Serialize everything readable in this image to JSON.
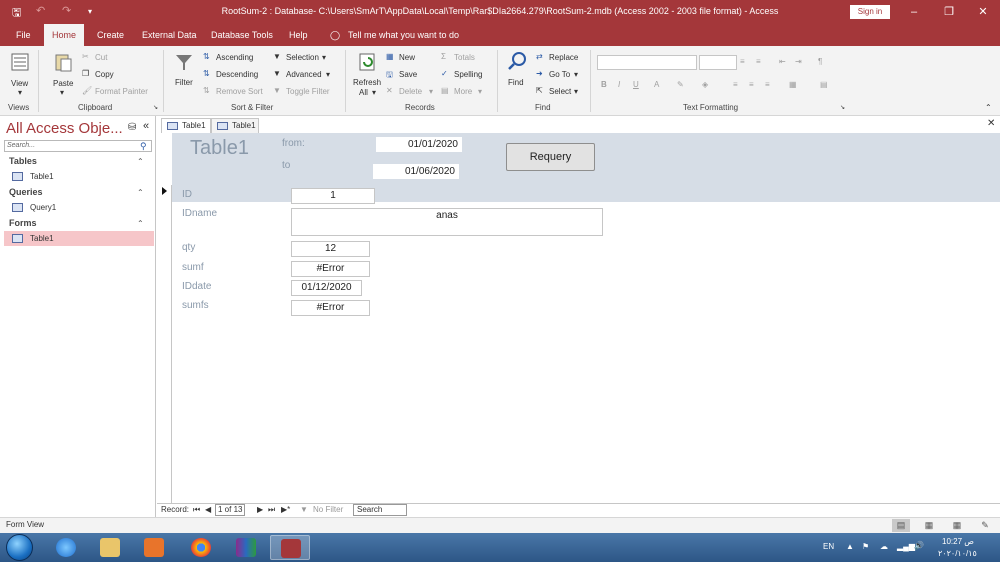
{
  "titlebar": {
    "title": "RootSum-2 : Database- C:\\Users\\SmArT\\AppData\\Local\\Temp\\Rar$DIa2664.279\\RootSum-2.mdb (Access 2002 - 2003 file format)  -  Access",
    "sign_in": "Sign in"
  },
  "ribbon_tabs": [
    "File",
    "Home",
    "Create",
    "External Data",
    "Database Tools",
    "Help"
  ],
  "tell_me": "Tell me what you want to do",
  "ribbon": {
    "views": {
      "view": "View",
      "group": "Views"
    },
    "clipboard": {
      "paste": "Paste",
      "cut": "Cut",
      "copy": "Copy",
      "format_painter": "Format Painter",
      "group": "Clipboard"
    },
    "sort_filter": {
      "filter": "Filter",
      "ascending": "Ascending",
      "descending": "Descending",
      "remove_sort": "Remove Sort",
      "selection": "Selection",
      "advanced": "Advanced",
      "toggle_filter": "Toggle Filter",
      "group": "Sort & Filter"
    },
    "records": {
      "refresh_all": "Refresh",
      "refresh_all2": "All",
      "new": "New",
      "save": "Save",
      "delete": "Delete",
      "totals": "Totals",
      "spelling": "Spelling",
      "more": "More",
      "group": "Records"
    },
    "find": {
      "find": "Find",
      "replace": "Replace",
      "goto": "Go To",
      "select": "Select",
      "group": "Find"
    },
    "text_formatting": {
      "group": "Text Formatting"
    }
  },
  "nav": {
    "title": "All Access Obje...",
    "search_placeholder": "Search...",
    "groups": [
      {
        "name": "Tables",
        "items": [
          "Table1"
        ]
      },
      {
        "name": "Queries",
        "items": [
          "Query1"
        ]
      },
      {
        "name": "Forms",
        "items": [
          "Table1"
        ]
      }
    ]
  },
  "doc_tabs": [
    "Table1",
    "Table1"
  ],
  "form": {
    "title": "Table1",
    "from_label": "from:",
    "from_value": "01/01/2020",
    "to_label": "to",
    "to_value": "01/06/2020",
    "requery": "Requery",
    "fields": [
      {
        "label": "ID",
        "value": "1"
      },
      {
        "label": "IDname",
        "value": "anas"
      },
      {
        "label": "qty",
        "value": "12"
      },
      {
        "label": "sumf",
        "value": "#Error"
      },
      {
        "label": "IDdate",
        "value": "01/12/2020"
      },
      {
        "label": "sumfs",
        "value": "#Error"
      }
    ]
  },
  "record_nav": {
    "label": "Record:",
    "position": "1 of 13",
    "no_filter": "No Filter",
    "search": "Search"
  },
  "status": {
    "text": "Form View"
  },
  "taskbar": {
    "lang": "EN",
    "time": "10:27 ص",
    "date": "٢٠٢٠/١٠/١٥"
  },
  "colors": {
    "accent": "#a4373a",
    "header_bg": "#d6dde6",
    "nav_selected": "#f6c6c9"
  }
}
